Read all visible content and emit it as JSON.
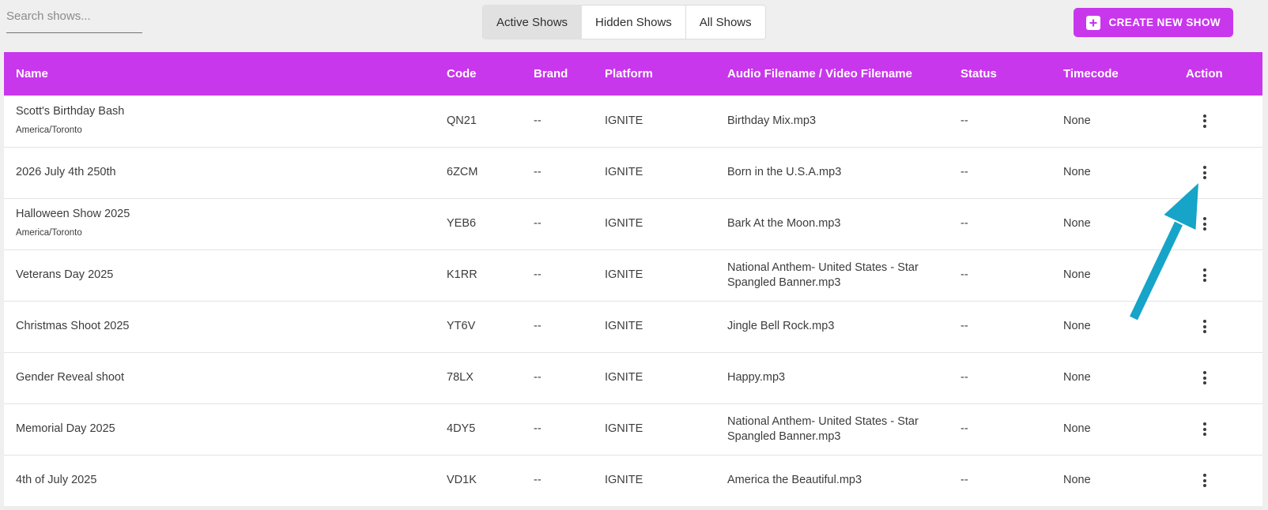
{
  "page": {
    "bg": "#efefef",
    "accent": "#c837ec",
    "arrow_color": "#16a4c8"
  },
  "search": {
    "placeholder": "Search shows..."
  },
  "tabs": [
    {
      "label": "Active Shows",
      "active": true
    },
    {
      "label": "Hidden Shows",
      "active": false
    },
    {
      "label": "All Shows",
      "active": false
    }
  ],
  "create_button": {
    "label": "CREATE NEW SHOW",
    "icon": "add-box-icon"
  },
  "table": {
    "columns": [
      "Name",
      "Code",
      "Brand",
      "Platform",
      "Audio Filename / Video Filename",
      "Status",
      "Timecode",
      "Action"
    ],
    "action_icon": "kebab-menu-icon",
    "rows": [
      {
        "name": "Scott's Birthday Bash",
        "timezone": "America/Toronto",
        "code": "QN21",
        "brand": "--",
        "platform": "IGNITE",
        "audio": "Birthday Mix.mp3",
        "status": "--",
        "timecode": "None"
      },
      {
        "name": "2026 July 4th 250th",
        "timezone": "",
        "code": "6ZCM",
        "brand": "--",
        "platform": "IGNITE",
        "audio": "Born in the U.S.A.mp3",
        "status": "--",
        "timecode": "None"
      },
      {
        "name": "Halloween Show 2025",
        "timezone": "America/Toronto",
        "code": "YEB6",
        "brand": "--",
        "platform": "IGNITE",
        "audio": "Bark At the Moon.mp3",
        "status": "--",
        "timecode": "None"
      },
      {
        "name": "Veterans Day 2025",
        "timezone": "",
        "code": "K1RR",
        "brand": "--",
        "platform": "IGNITE",
        "audio": "National Anthem- United States - Star Spangled Banner.mp3",
        "status": "--",
        "timecode": "None"
      },
      {
        "name": "Christmas Shoot 2025",
        "timezone": "",
        "code": "YT6V",
        "brand": "--",
        "platform": "IGNITE",
        "audio": "Jingle Bell Rock.mp3",
        "status": "--",
        "timecode": "None"
      },
      {
        "name": "Gender Reveal shoot",
        "timezone": "",
        "code": "78LX",
        "brand": "--",
        "platform": "IGNITE",
        "audio": "Happy.mp3",
        "status": "--",
        "timecode": "None"
      },
      {
        "name": "Memorial Day 2025",
        "timezone": "",
        "code": "4DY5",
        "brand": "--",
        "platform": "IGNITE",
        "audio": "National Anthem- United States - Star Spangled Banner.mp3",
        "status": "--",
        "timecode": "None"
      },
      {
        "name": "4th of July 2025",
        "timezone": "",
        "code": "VD1K",
        "brand": "--",
        "platform": "IGNITE",
        "audio": "America the Beautiful.mp3",
        "status": "--",
        "timecode": "None"
      }
    ]
  },
  "annotation": {
    "description": "teal arrow pointing to row 2 actions menu"
  }
}
